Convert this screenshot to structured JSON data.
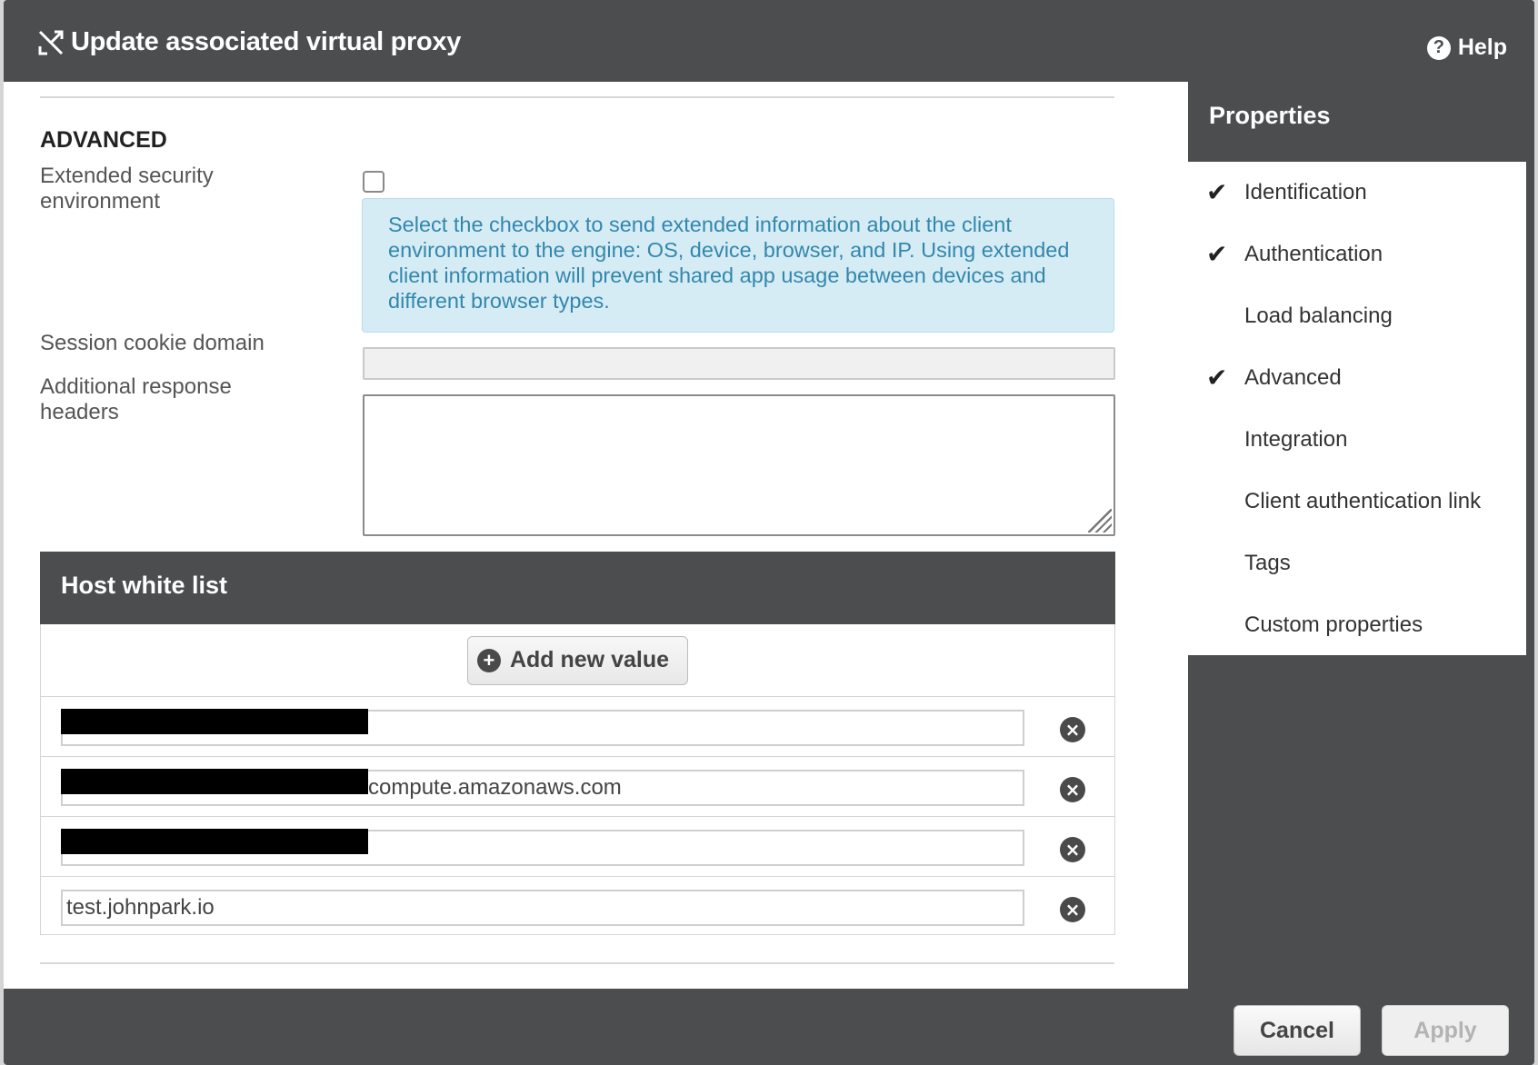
{
  "dialog": {
    "title": "Update associated virtual proxy",
    "title_icon": "proxy-icon",
    "help_label": "Help"
  },
  "advanced": {
    "section_title": "ADVANCED",
    "extended_security_label": "Extended security environment",
    "extended_security_checked": false,
    "extended_security_info": "Select the checkbox to send extended information about the client environment to the engine: OS, device, browser, and IP. Using extended client information will prevent shared app usage between devices and different browser types.",
    "session_cookie_label": "Session cookie domain",
    "session_cookie_value": "",
    "response_headers_label": "Additional response headers",
    "response_headers_value": ""
  },
  "host_white_list": {
    "title": "Host white list",
    "add_button_label": "Add new value",
    "entries": [
      {
        "value": "",
        "redacted": true
      },
      {
        "value": "compute.amazonaws.com",
        "redacted": true
      },
      {
        "value": "",
        "redacted": true
      },
      {
        "value": "test.johnpark.io",
        "redacted": false
      }
    ]
  },
  "properties": {
    "title": "Properties",
    "items": [
      {
        "label": "Identification",
        "checked": true
      },
      {
        "label": "Authentication",
        "checked": true
      },
      {
        "label": "Load balancing",
        "checked": false
      },
      {
        "label": "Advanced",
        "checked": true
      },
      {
        "label": "Integration",
        "checked": false
      },
      {
        "label": "Client authentication link",
        "checked": false
      },
      {
        "label": "Tags",
        "checked": false
      },
      {
        "label": "Custom properties",
        "checked": false
      }
    ]
  },
  "footer": {
    "cancel_label": "Cancel",
    "apply_label": "Apply",
    "apply_enabled": false
  }
}
